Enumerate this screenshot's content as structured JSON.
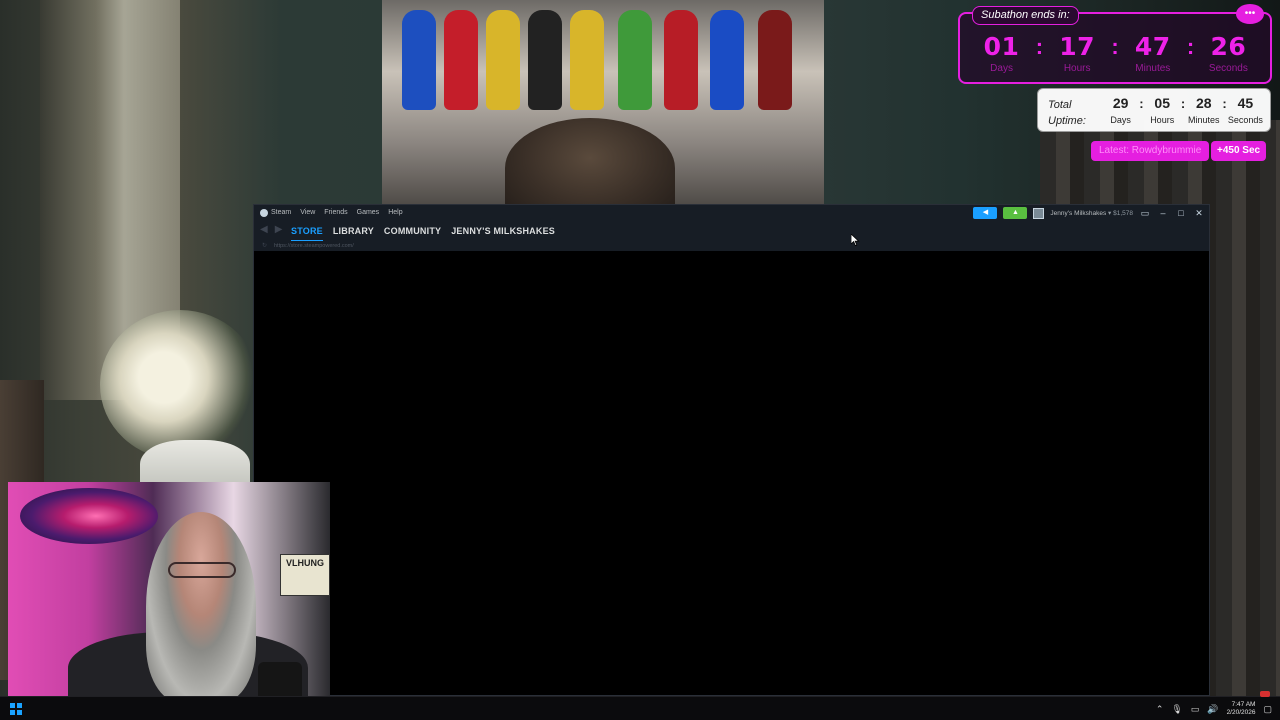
{
  "subathon": {
    "header": "Subathon ends in:",
    "days": "01",
    "hours": "17",
    "minutes": "47",
    "seconds": "26",
    "labels": {
      "days": "Days",
      "hours": "Hours",
      "minutes": "Minutes",
      "seconds": "Seconds"
    },
    "separator": ":"
  },
  "uptime": {
    "title_line1": "Total",
    "title_line2": "Uptime:",
    "days": "29",
    "hours": "05",
    "minutes": "28",
    "seconds": "45",
    "labels": {
      "days": "Days",
      "hours": "Hours",
      "minutes": "Minutes",
      "seconds": "Seconds"
    },
    "separator": ":"
  },
  "latest": {
    "text": "Latest: Rowdybrummie",
    "bonus": "+450 Sec"
  },
  "steam": {
    "menu": [
      "Steam",
      "View",
      "Friends",
      "Games",
      "Help"
    ],
    "tabs": [
      "STORE",
      "LIBRARY",
      "COMMUNITY",
      "JENNY'S MILKSHAKES"
    ],
    "active_tab": "STORE",
    "url": "https://store.steampowered.com/",
    "account_name": "Jenny's Milkshakes",
    "wallet": "$1,578",
    "colors": {
      "accent": "#1a9fff",
      "bg": "#171d25",
      "notification": "#59bf40"
    }
  },
  "cam": {
    "plate_line1": "VLHUNG",
    "plate_line2": ""
  },
  "taskbar": {
    "time": "7:47 AM",
    "date": "2/20/2026"
  },
  "colors": {
    "overlay_magenta": "#e51fe0"
  }
}
